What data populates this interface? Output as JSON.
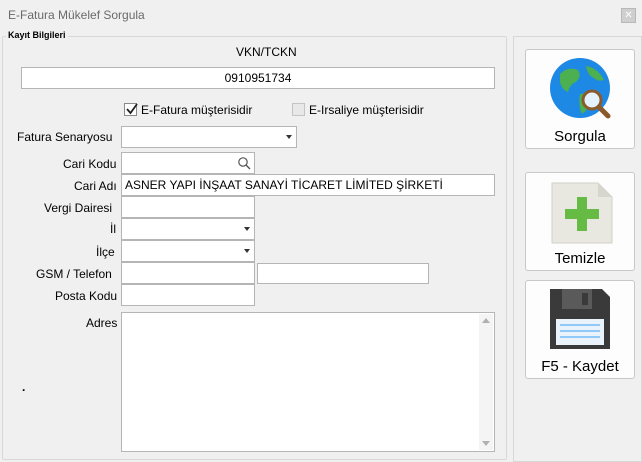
{
  "window": {
    "title": "E-Fatura Mükelef Sorgula"
  },
  "group": {
    "label": "Kayıt Bilgileri"
  },
  "vkn": {
    "label": "VKN/TCKN",
    "value": "0910951734"
  },
  "checkboxes": {
    "efatura": {
      "label": "E-Fatura müşterisidir",
      "checked": true
    },
    "eirsaliye": {
      "label": "E-Irsaliye müşterisidir",
      "checked": false
    }
  },
  "form": {
    "fatura_senaryosu": {
      "label": "Fatura Senaryosu",
      "value": ""
    },
    "cari_kodu": {
      "label": "Cari Kodu",
      "value": ""
    },
    "cari_adi": {
      "label": "Cari Adı",
      "value": "ASNER YAPI İNŞAAT SANAYİ TİCARET LİMİTED ŞİRKETİ"
    },
    "vergi_dairesi": {
      "label": "Vergi Dairesi",
      "value": ""
    },
    "il": {
      "label": "İl",
      "value": ""
    },
    "ilce": {
      "label": "İlçe",
      "value": ""
    },
    "gsm": {
      "label": "GSM / Telefon",
      "value1": "",
      "value2": ""
    },
    "posta_kodu": {
      "label": "Posta Kodu",
      "value": ""
    },
    "adres": {
      "label": "Adres",
      "value": ""
    },
    "dot": "."
  },
  "buttons": {
    "sorgula": {
      "label": "Sorgula",
      "icon": "globe-search-icon"
    },
    "temizle": {
      "label": "Temizle",
      "icon": "new-document-plus-icon"
    },
    "kaydet": {
      "label": "F5 - Kaydet",
      "icon": "floppy-disk-icon"
    }
  },
  "colors": {
    "accent_green": "#4caf50",
    "globe_blue": "#1e88e5",
    "floppy_dark": "#3a3a3a"
  }
}
